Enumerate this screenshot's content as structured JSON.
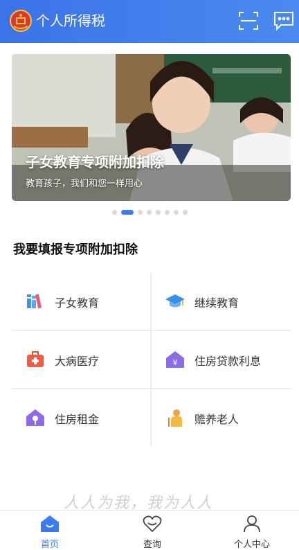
{
  "header": {
    "title": "个人所得税",
    "logo_icon": "tax-emblem-icon",
    "actions": [
      "scan-icon",
      "message-icon"
    ],
    "color": "#3b73e8"
  },
  "banner": {
    "title": "子女教育专项附加扣除",
    "subtitle": "教育孩子，我们和您一样用心",
    "pager_count": 8,
    "active_index": 1
  },
  "section": {
    "title": "我要填报专项附加扣除"
  },
  "deductions": [
    {
      "label": "子女教育",
      "icon": "books-icon"
    },
    {
      "label": "继续教育",
      "icon": "graduation-cap-icon"
    },
    {
      "label": "大病医疗",
      "icon": "medical-kit-icon"
    },
    {
      "label": "住房贷款利息",
      "icon": "house-yuan-icon"
    },
    {
      "label": "住房租金",
      "icon": "house-key-icon"
    },
    {
      "label": "赡养老人",
      "icon": "elderly-person-icon"
    }
  ],
  "watermark": "人人为我，我为人人",
  "tabbar": [
    {
      "label": "首页",
      "icon": "home-icon",
      "active": true
    },
    {
      "label": "查询",
      "icon": "heart-search-icon",
      "active": false
    },
    {
      "label": "个人中心",
      "icon": "person-icon",
      "active": false
    }
  ],
  "accent_color": "#3b7cf0"
}
